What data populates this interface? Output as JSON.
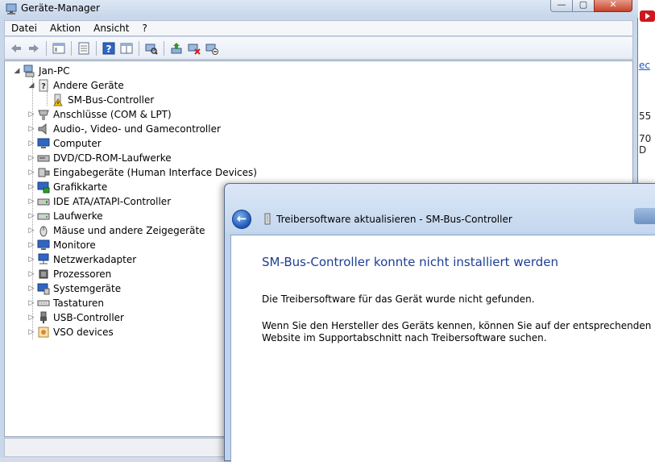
{
  "window": {
    "title": "Geräte-Manager",
    "minimize_icon": "minimize-icon",
    "maximize_icon": "maximize-icon",
    "close_icon": "close-icon",
    "min_glyph": "—",
    "max_glyph": "▢",
    "close_glyph": "✕"
  },
  "menu": {
    "items": [
      "Datei",
      "Aktion",
      "Ansicht",
      "?"
    ]
  },
  "toolbar": {
    "buttons": [
      "back-icon",
      "forward-icon",
      "tree-view-icon",
      "properties-icon",
      "help-icon",
      "pane-icon",
      "scan-hardware-icon",
      "update-driver-icon",
      "uninstall-icon",
      "disable-icon"
    ]
  },
  "tree": {
    "root": "Jan-PC",
    "other_devices": "Andere Geräte",
    "smbus": "SM-Bus-Controller",
    "categories": [
      "Anschlüsse (COM & LPT)",
      "Audio-, Video- und Gamecontroller",
      "Computer",
      "DVD/CD-ROM-Laufwerke",
      "Eingabegeräte (Human Interface Devices)",
      "Grafikkarte",
      "IDE ATA/ATAPI-Controller",
      "Laufwerke",
      "Mäuse und andere Zeigegeräte",
      "Monitore",
      "Netzwerkadapter",
      "Prozessoren",
      "Systemgeräte",
      "Tastaturen",
      "USB-Controller",
      "VSO devices"
    ]
  },
  "background": {
    "link_fragment": "ec",
    "num1": "55",
    "num2": "70 D"
  },
  "dialog": {
    "title": "Treibersoftware aktualisieren - SM-Bus-Controller",
    "back_glyph": "←",
    "heading": "SM-Bus-Controller konnte nicht installiert werden",
    "message1": "Die Treibersoftware für das Gerät wurde nicht gefunden.",
    "message2": "Wenn Sie den Hersteller des Geräts kennen, können Sie auf der entsprechenden Website im Supportabschnitt nach Treibersoftware suchen."
  },
  "colors": {
    "heading_blue": "#1e3e93",
    "warning_yellow": "#f5c400",
    "close_red": "#c7422a"
  }
}
